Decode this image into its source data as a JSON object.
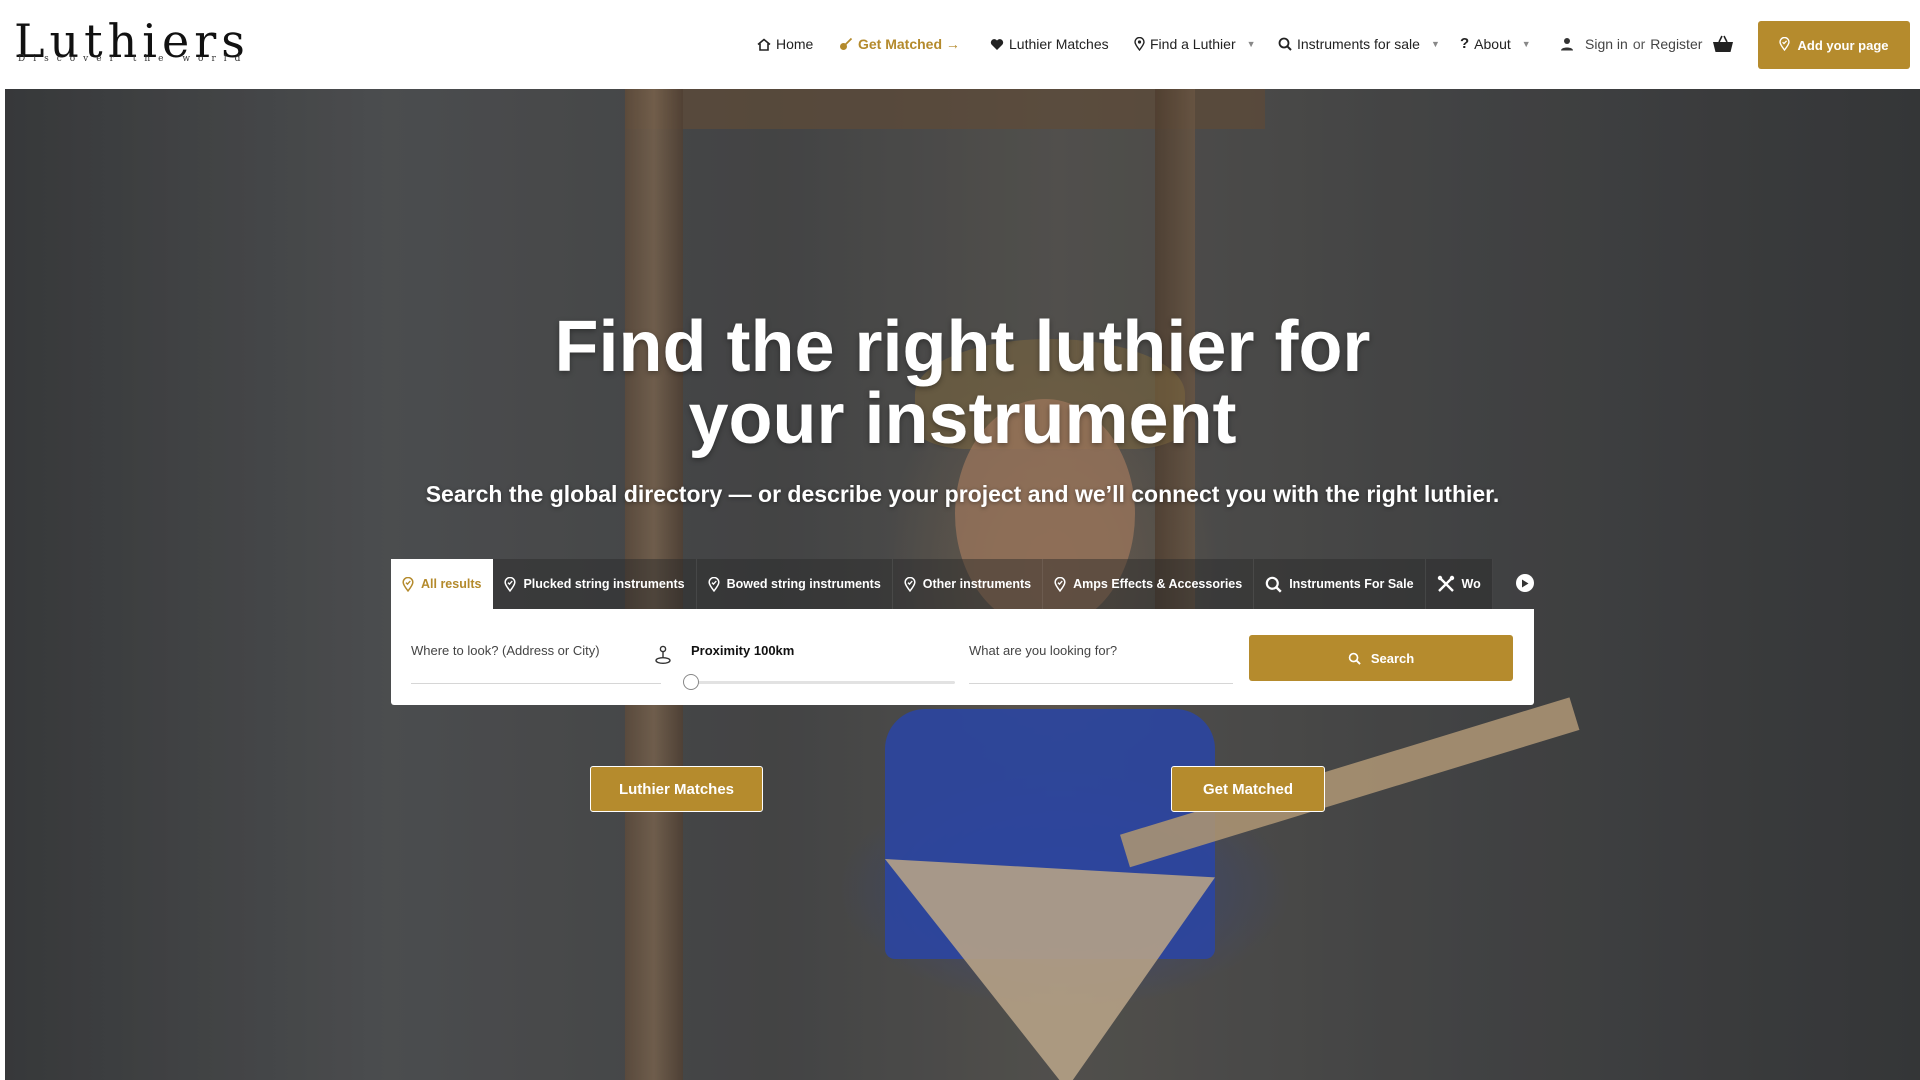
{
  "brand": {
    "name": "Luthiers",
    "tagline": "Discover the world",
    "accent_color": "#b58b2d"
  },
  "nav": {
    "home": "Home",
    "get_matched": "Get Matched →",
    "luthier_matches": "Luthier Matches",
    "find_luthier": "Find a Luthier",
    "instruments_for_sale": "Instruments for sale",
    "about": "About",
    "sign_in": "Sign in",
    "or": "or",
    "register": "Register",
    "add_page": "Add your page"
  },
  "hero": {
    "title_line1": "Find the right luthier for",
    "title_line2": "your instrument",
    "subtitle": "Search the global directory — or describe your project and we’ll connect you with the right luthier."
  },
  "tabs": [
    {
      "label": "All results",
      "icon": "map-pin-icon",
      "active": true
    },
    {
      "label": "Plucked string instruments",
      "icon": "map-pin-icon",
      "active": false
    },
    {
      "label": "Bowed string instruments",
      "icon": "map-pin-icon",
      "active": false
    },
    {
      "label": "Other instruments",
      "icon": "map-pin-icon",
      "active": false
    },
    {
      "label": "Amps Effects & Accessories",
      "icon": "map-pin-icon",
      "active": false
    },
    {
      "label": "Instruments For Sale",
      "icon": "search-icon",
      "active": false
    },
    {
      "label": "Wo",
      "icon": "tools-icon",
      "active": false
    }
  ],
  "search": {
    "location_placeholder": "Where to look? (Address or City)",
    "proximity_label": "Proximity 100km",
    "proximity_value": 0,
    "query_placeholder": "What are you looking for?",
    "button_label": "Search"
  },
  "cta": {
    "luthier_matches": "Luthier Matches",
    "get_matched": "Get Matched"
  }
}
